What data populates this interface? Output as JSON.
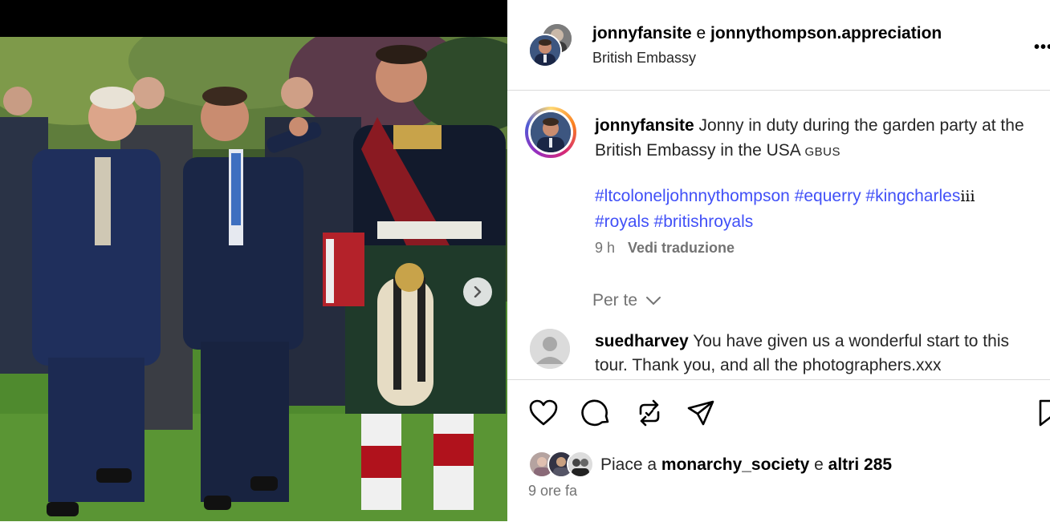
{
  "post": {
    "header": {
      "user1": "jonnyfansite",
      "joiner": " e ",
      "user2": "jonnythompson.appreciation",
      "location": "British Embassy",
      "more_label": "•••"
    },
    "caption": {
      "username": "jonnyfansite",
      "text": " Jonny in duty during the garden party at the British Embassy in the USA ",
      "flags": "GBUS",
      "hashtags": [
        "#ltcoloneljohnnythompson",
        "#equerry",
        "#kingcharles"
      ],
      "hashtag_suffix": "iii",
      "hashtags2": [
        "#royals",
        "#britishroyals"
      ],
      "age": "9 h",
      "translate": "Vedi traduzione"
    },
    "for_you": "Per te",
    "comment": {
      "username": "suedharvey",
      "text": " You have given us a wonderful start to this tour. Thank you, and all the photographers.xxx"
    },
    "likes": {
      "prefix": "Piace a ",
      "user": "monarchy_society",
      "joiner": " e ",
      "others": "altri 285"
    },
    "time_ago": "9 ore fa"
  },
  "icons": [
    "chevron-right-icon",
    "heart-icon",
    "comment-icon",
    "repost-icon",
    "share-icon",
    "bookmark-icon",
    "chevron-down-icon",
    "more-icon"
  ],
  "colors": {
    "hashtag": "#4150f7",
    "muted": "#737373",
    "border": "#dbdbdb"
  }
}
